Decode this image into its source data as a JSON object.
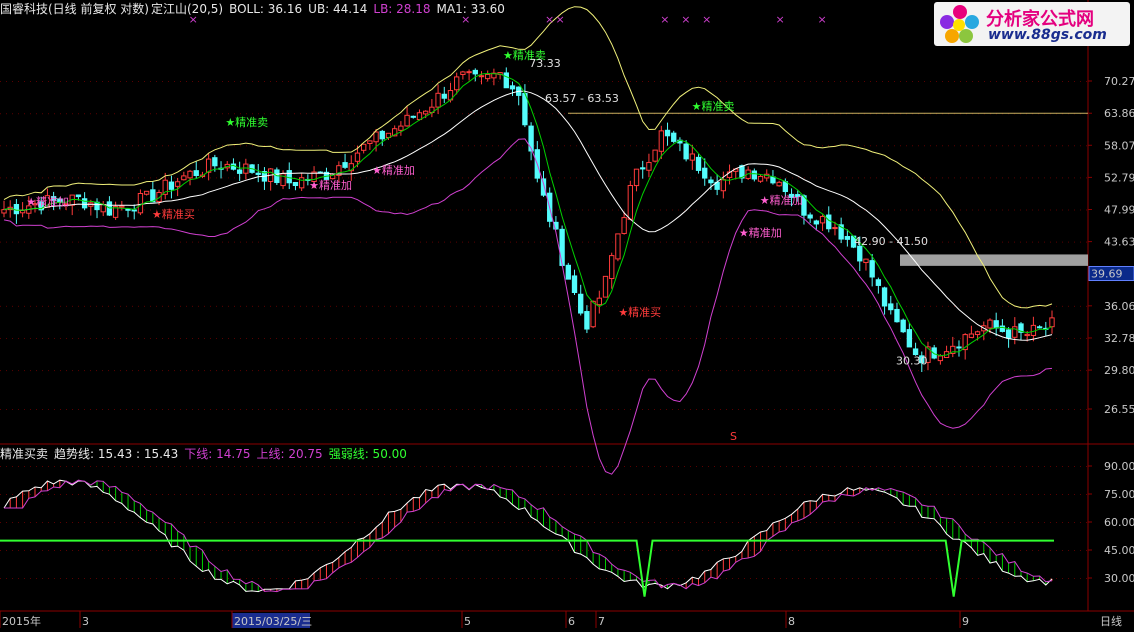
{
  "header_top": {
    "title": "国睿科技(日线 前复权 对数)",
    "indicator": "定江山(20,5)",
    "boll_label": "BOLL: 36.16",
    "ub_label": "UB: 44.14",
    "lb_label": "LB: 28.18",
    "ma1_label": "MA1: 33.60"
  },
  "header_bottom": {
    "title": "精准买卖",
    "trend_label": "趋势线: 15.43 : 15.43",
    "lower_label": "下线: 14.75",
    "upper_label": "上线: 20.75",
    "strength_label": "强弱线: 50.00"
  },
  "logo": {
    "text1": "分析家公式网",
    "text2": "www.88gs.com"
  },
  "price_axis": [
    "70.27",
    "63.86",
    "58.07",
    "52.79",
    "47.99",
    "43.63",
    "36.06",
    "32.78",
    "29.80",
    "26.55"
  ],
  "price_tag": "39.69",
  "osc_axis": [
    "90.00",
    "75.00",
    "60.00",
    "45.00",
    "30.00"
  ],
  "date_labels": [
    "2015年",
    "3",
    "2015/03/25/三",
    "5",
    "6",
    "7",
    "8",
    "9"
  ],
  "period_label": "日线",
  "s_marker": "S",
  "colors": {
    "up": "#ff3b3b",
    "down": "#54fcfc",
    "ma": "#00d000",
    "upper": "#f0f07a",
    "lower": "#d040d0",
    "mid": "#ffffff",
    "buy": "#ff3b3b",
    "sell": "#30ff30",
    "add": "#ff5fd0",
    "strong": "#30ff30",
    "grid": "#8b0000"
  },
  "annotations": [
    {
      "type": "精准加",
      "color": "add",
      "t": 0.025,
      "p": 48.6
    },
    {
      "type": "精准买",
      "color": "buy",
      "t": 0.145,
      "p": 46.8
    },
    {
      "type": "精准卖",
      "color": "sell",
      "t": 0.215,
      "p": 61.5
    },
    {
      "type": "精准加",
      "color": "add",
      "t": 0.295,
      "p": 51.0
    },
    {
      "type": "精准加",
      "color": "add",
      "t": 0.355,
      "p": 53.3
    },
    {
      "type": "精准卖",
      "color": "sell",
      "t": 0.48,
      "p": 75.0
    },
    {
      "type": "精准买",
      "color": "buy",
      "t": 0.59,
      "p": 35.0
    },
    {
      "type": "精准卖",
      "color": "sell",
      "t": 0.66,
      "p": 64.5
    },
    {
      "type": "精准加",
      "color": "add",
      "t": 0.725,
      "p": 48.8
    },
    {
      "type": "精准加",
      "color": "add",
      "t": 0.705,
      "p": 44.3
    }
  ],
  "price_notes": [
    {
      "text": "73.33",
      "t": 0.505,
      "p": 73.3
    },
    {
      "text": "63.57 - 63.53",
      "t": 0.52,
      "p": 66.0
    },
    {
      "text": "42.90 - 41.50",
      "t": 0.815,
      "p": 43.2
    },
    {
      "text": "30.30",
      "t": 0.855,
      "p": 30.3
    }
  ],
  "chart_data": {
    "type": "candlestick",
    "scale": "log",
    "ylim": [
      25.0,
      80.0
    ],
    "hline": 63.86,
    "band_box": [
      40.6,
      42.0
    ],
    "candles": [],
    "series": [],
    "oscillator": {
      "ylim": [
        15,
        100
      ],
      "strength_value": 50.0,
      "notch_positions": [
        0.615,
        0.91
      ]
    }
  }
}
